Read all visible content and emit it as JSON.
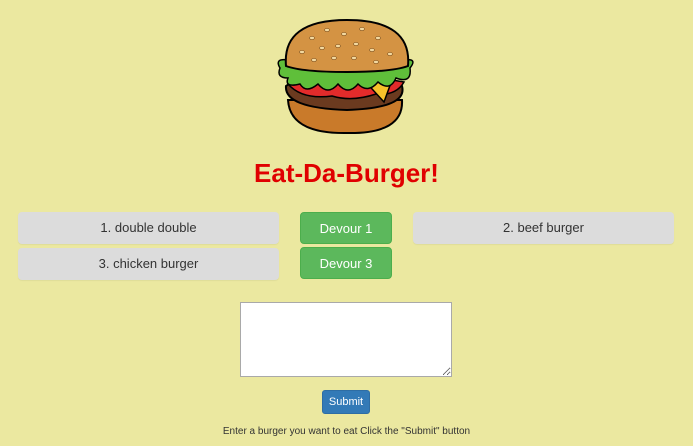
{
  "header": {
    "logo_icon": "burger-icon",
    "title": "Eat-Da-Burger!",
    "title_color": "#e00000"
  },
  "uneaten": {
    "items": [
      {
        "label": "1. double double",
        "button_label": "Devour 1"
      },
      {
        "label": "3. chicken burger",
        "button_label": "Devour 3"
      }
    ]
  },
  "devoured": {
    "items": [
      {
        "label": "2. beef burger"
      }
    ]
  },
  "form": {
    "textarea_value": "",
    "submit_label": "Submit",
    "instructions": "Enter a burger you want to eat Click the \"Submit\" button"
  },
  "colors": {
    "background": "#ebe8a0",
    "item_bg": "#dcdcdc",
    "devour_button": "#5cb85c",
    "submit_button": "#337ab7"
  }
}
